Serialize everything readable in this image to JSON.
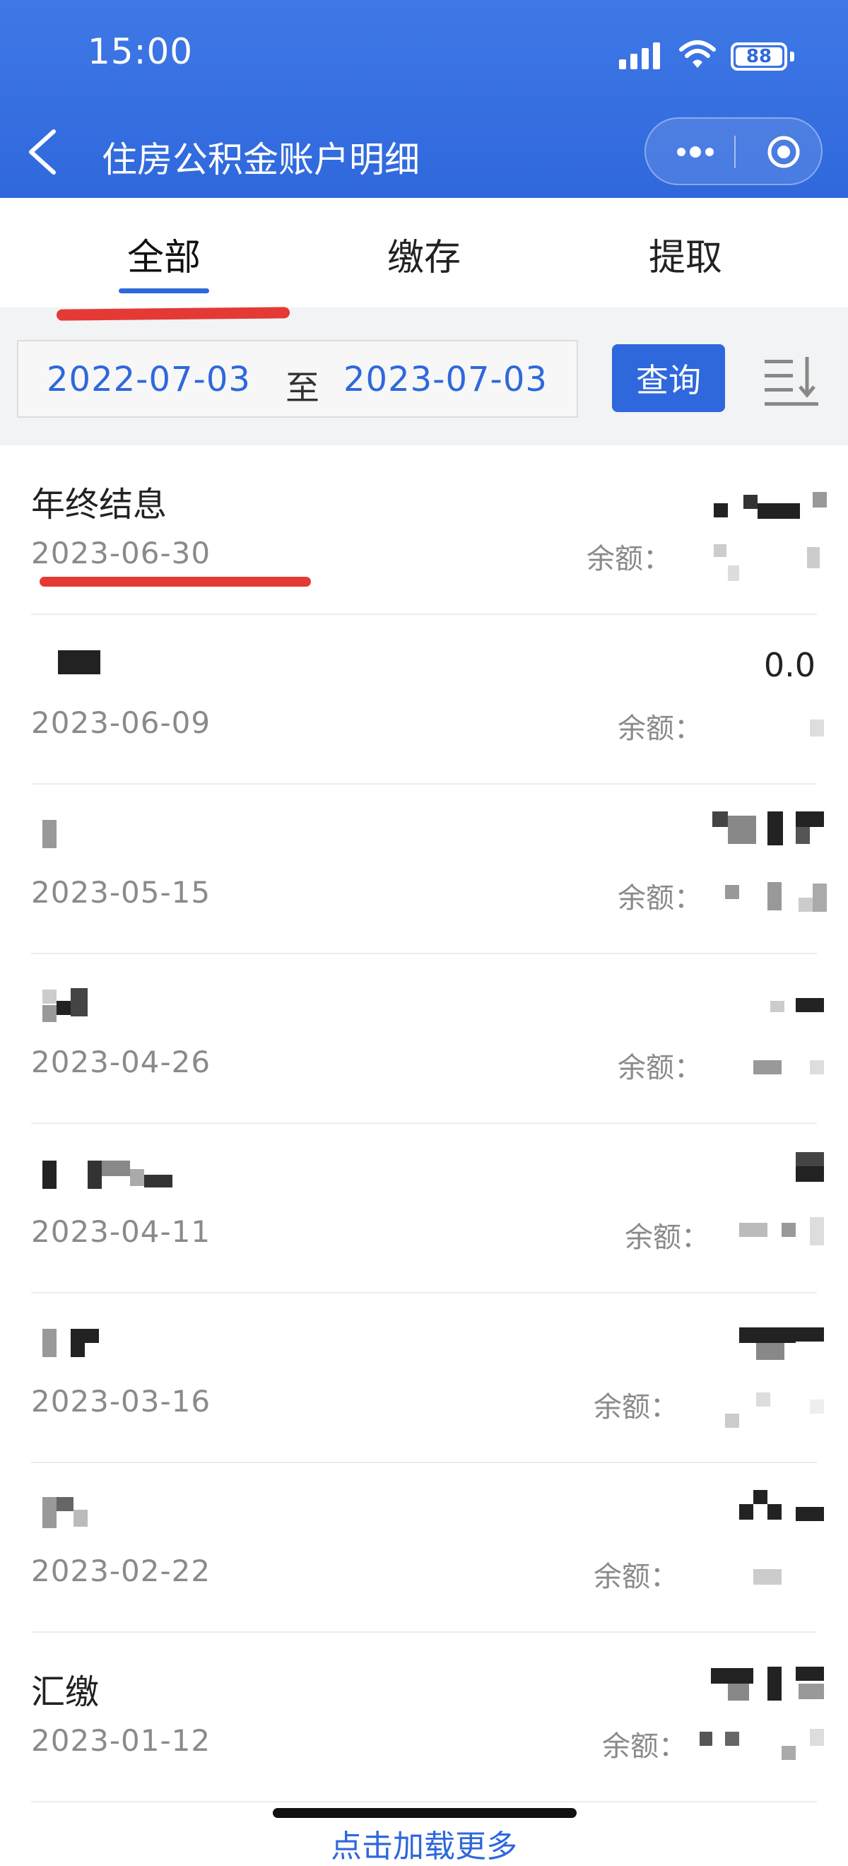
{
  "status_bar": {
    "time": "15:00",
    "battery": "88",
    "icons": [
      "signal-icon",
      "wifi-icon",
      "battery-icon"
    ]
  },
  "nav": {
    "title": "住房公积金账户明细",
    "back_icon": "chevron-left-icon",
    "more_icon": "more-dots-icon",
    "close_icon": "target-circle-icon"
  },
  "tabs": [
    {
      "label": "全部",
      "active": true
    },
    {
      "label": "缴存",
      "active": false
    },
    {
      "label": "提取",
      "active": false
    }
  ],
  "filter": {
    "start_date": "2022-07-03",
    "separator": "至",
    "end_date": "2023-07-03",
    "query_label": "查询",
    "sort_icon": "sort-descending-icon"
  },
  "records": [
    {
      "title": "年终结息",
      "date": "2023-06-30",
      "balance_label": "余额：",
      "amount": ""
    },
    {
      "title": "",
      "date": "2023-06-09",
      "balance_label": "余额：",
      "amount": "0.0"
    },
    {
      "title": "",
      "date": "2023-05-15",
      "balance_label": "余额：",
      "amount": ""
    },
    {
      "title": "",
      "date": "2023-04-26",
      "balance_label": "余额：",
      "amount": ""
    },
    {
      "title": "",
      "date": "2023-04-11",
      "balance_label": "余额：",
      "amount": ""
    },
    {
      "title": "",
      "date": "2023-03-16",
      "balance_label": "余额：",
      "amount": ""
    },
    {
      "title": "",
      "date": "2023-02-22",
      "balance_label": "余额：",
      "amount": ""
    },
    {
      "title": "汇缴",
      "date": "2023-01-12",
      "balance_label": "余额：",
      "amount": ""
    }
  ],
  "footer": {
    "load_more": "点击加载更多"
  },
  "colors": {
    "brand": "#2f68dc",
    "annotation_red": "#e53935"
  }
}
